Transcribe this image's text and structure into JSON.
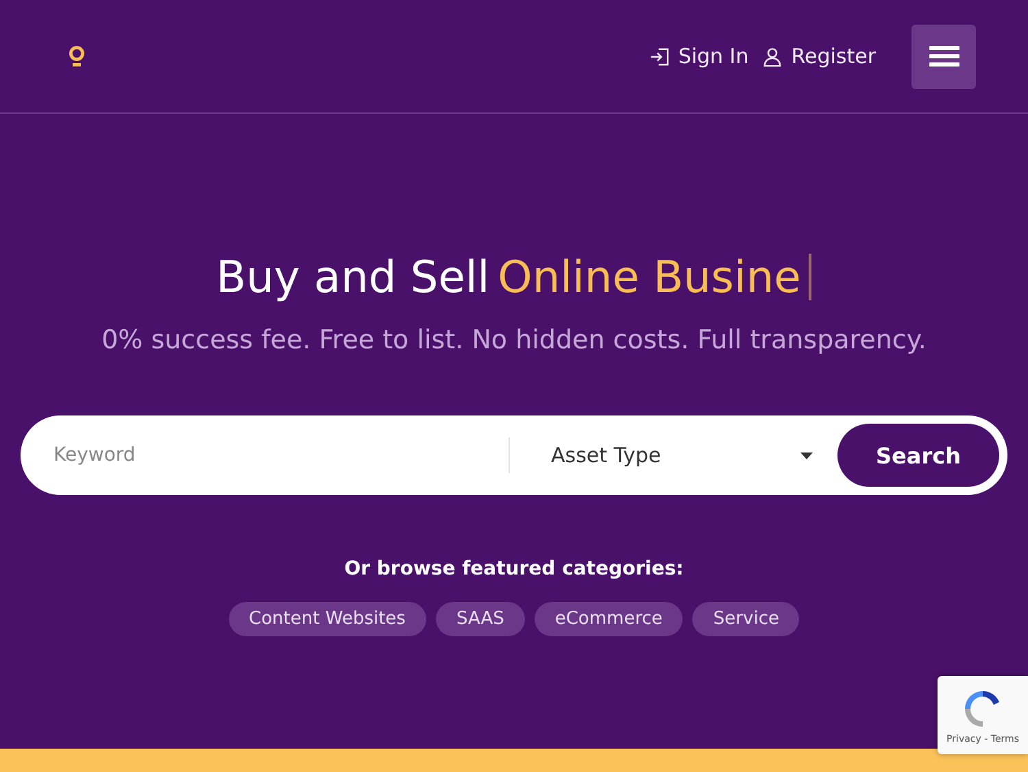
{
  "header": {
    "links": [
      {
        "kind": "signin",
        "label": "Sign In"
      },
      {
        "kind": "register",
        "label": "Register"
      }
    ]
  },
  "hero": {
    "title": "Buy and Sell",
    "title_highlight": "Online Busine",
    "subtitle": "0% success fee. Free to list. No hidden costs. Full transparency."
  },
  "search": {
    "keyword": {
      "placeholder": "Keyword"
    },
    "asset_type": "Asset Type",
    "button": "Search"
  },
  "categories": {
    "heading": "Or browse featured categories:",
    "items": [
      "Content Websites",
      "SAAS",
      "eCommerce",
      "Service"
    ]
  },
  "recaptcha": {
    "text": "Privacy - Terms"
  }
}
